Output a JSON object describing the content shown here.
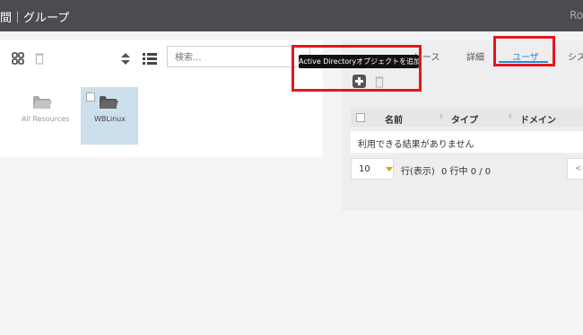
{
  "header": {
    "title": "間｜グループ",
    "user_text": "Ro"
  },
  "toolbar": {
    "search_placeholder": "検索..."
  },
  "tiles": [
    {
      "label": "All Resources",
      "selected": false
    },
    {
      "label": "WBLinux",
      "selected": true
    }
  ],
  "tooltip": {
    "text": "Active Directoryオブジェクトを追加"
  },
  "tabs": [
    {
      "label": "リース",
      "active": false
    },
    {
      "label": "詳細",
      "active": false
    },
    {
      "label": "ユーザ",
      "active": true
    },
    {
      "label": "シス",
      "active": false
    }
  ],
  "table": {
    "columns": [
      "名前",
      "タイプ",
      "ドメイン"
    ],
    "empty_message": "利用できる結果がありません"
  },
  "pager": {
    "page_size": "10",
    "rows_label": "行(表示)",
    "range_text": "0 行中 0 / 0",
    "prev_label": "<<"
  },
  "colors": {
    "highlight_box": "#e4161b",
    "accent": "#2a8ad0",
    "topbar": "#4b4c50"
  }
}
